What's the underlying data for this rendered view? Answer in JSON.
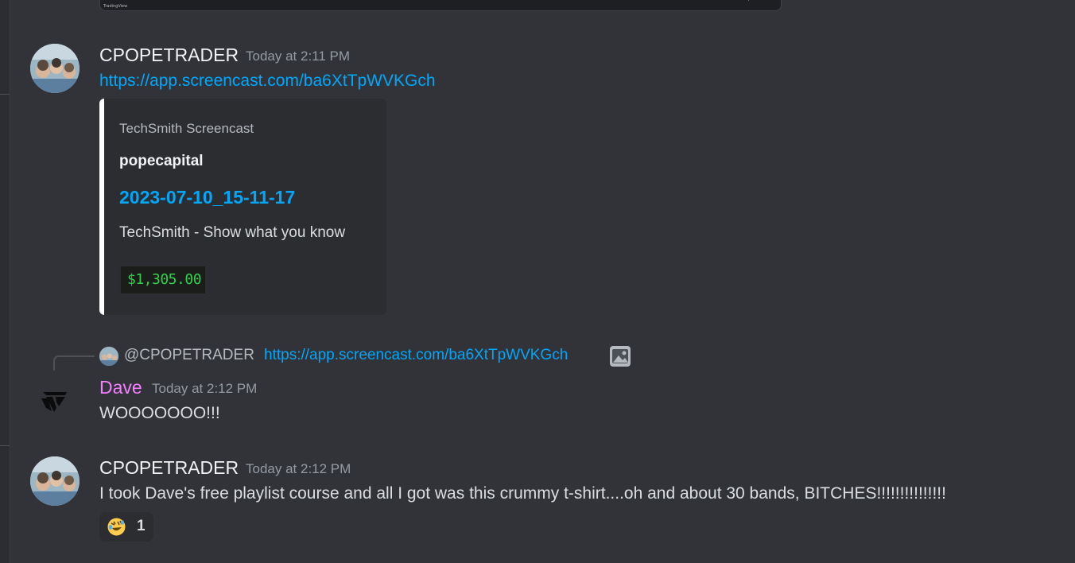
{
  "previous_embed": {
    "watermark": "TradingView"
  },
  "messages": [
    {
      "author": "CPOPETRADER",
      "timestamp": "Today at 2:11 PM",
      "link": "https://app.screencast.com/ba6XtTpWVKGch",
      "embed": {
        "provider": "TechSmith Screencast",
        "author": "popecapital",
        "title": "2023-07-10_15-11-17",
        "description": "TechSmith - Show what you know",
        "thumbnail_text": "$1,305.00",
        "bar_color": "#ffffff"
      }
    },
    {
      "reply": {
        "mention": "@CPOPETRADER",
        "link": "https://app.screencast.com/ba6XtTpWVKGch",
        "attachment_icon": "image-icon"
      },
      "author": "Dave",
      "author_color": "#f47fff",
      "timestamp": "Today at 2:12 PM",
      "text": "WOOOOOOO!!!"
    },
    {
      "author": "CPOPETRADER",
      "timestamp": "Today at 2:12 PM",
      "text": "I took Dave's free playlist course and all I got was this crummy t-shirt....oh and about 30 bands, BITCHES!!!!!!!!!!!!!!!",
      "reactions": [
        {
          "emoji": "rolling-on-floor-laughing-emoji",
          "count": "1"
        }
      ]
    }
  ],
  "colors": {
    "background": "#313338",
    "link": "#00a8fc",
    "username": "#f2f3f5",
    "timestamp": "#949ba4"
  }
}
